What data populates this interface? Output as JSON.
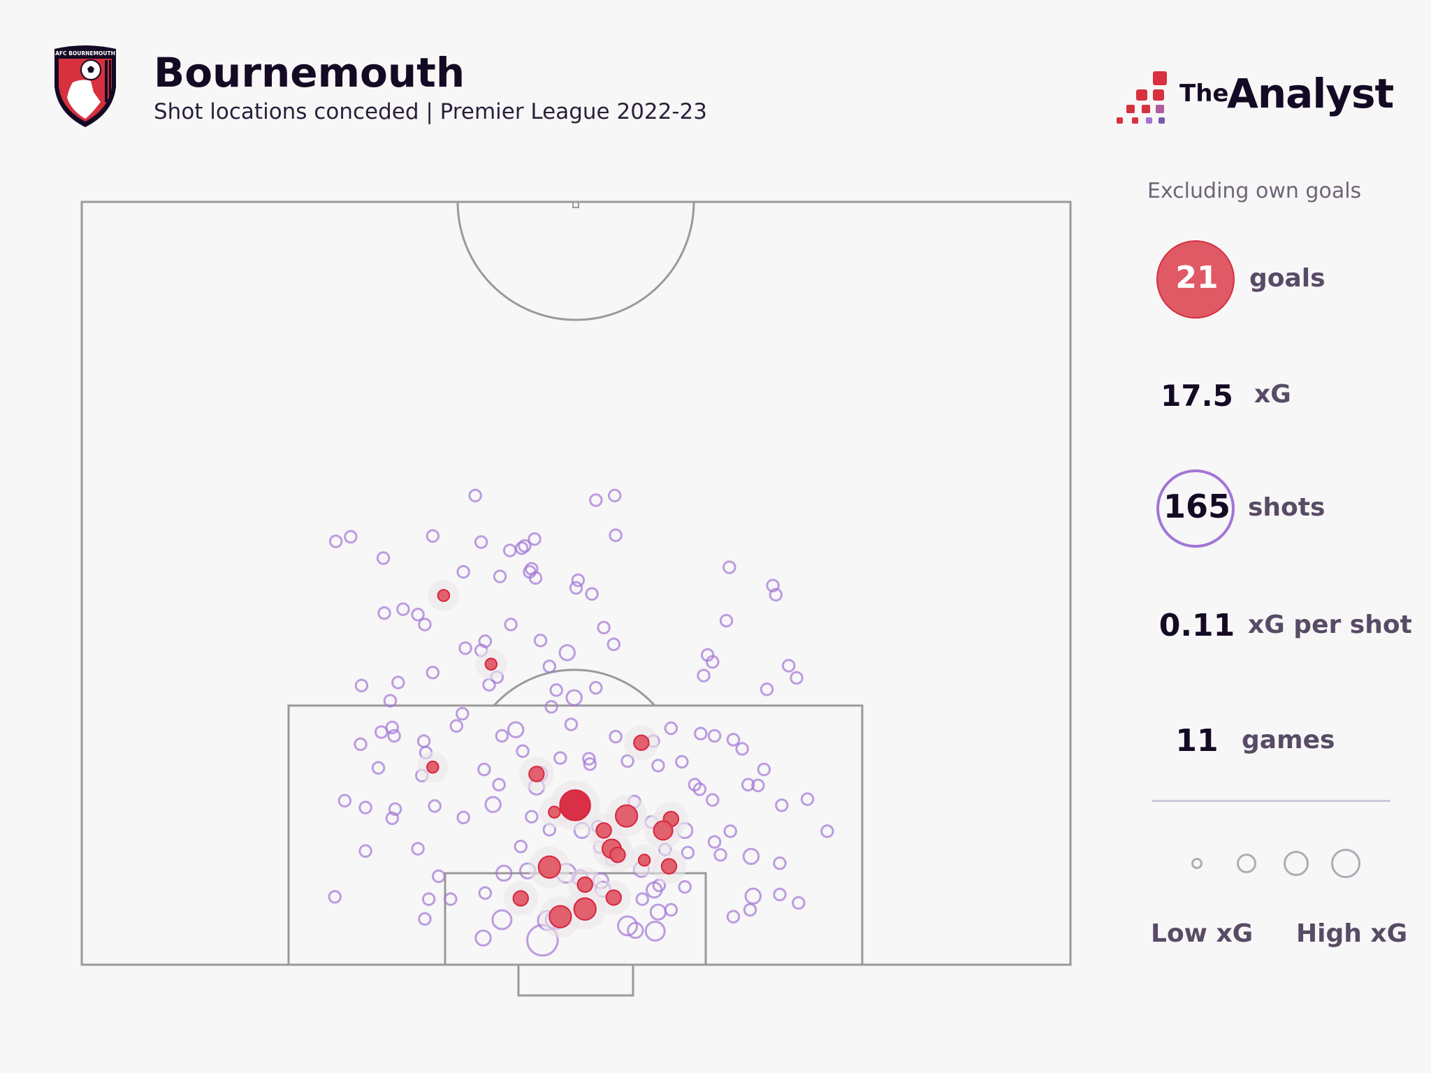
{
  "header": {
    "title": "Bournemouth",
    "subtitle": "Shot locations conceded | Premier League 2022-23",
    "crest_text": "AFC BOURNEMOUTH",
    "brand_the": "The",
    "brand_analyst": "Analyst"
  },
  "colors": {
    "goal": "#d7263d",
    "goal_fill": "#e05a66",
    "shot": "#a375d6",
    "pitch_line": "#9a9a9a",
    "background": "#f7f7f7",
    "brand_red": "#d7303f",
    "brand_purple": "#a375d6"
  },
  "stats": {
    "note": "Excluding own goals",
    "goals": {
      "value": "21",
      "label": "goals"
    },
    "xg": {
      "value": "17.5",
      "label": "xG"
    },
    "shots": {
      "value": "165",
      "label": "shots"
    },
    "xg_per_shot": {
      "value": "0.11",
      "label": "xG per shot"
    },
    "games": {
      "value": "11",
      "label": "games"
    }
  },
  "legend": {
    "low_label": "Low xG",
    "high_label": "High xG",
    "sizes_xg": [
      0.02,
      0.1,
      0.25,
      0.5
    ]
  },
  "chart_data": {
    "type": "scatter",
    "title": "Bournemouth",
    "subtitle": "Shot locations conceded | Premier League 2022-23",
    "xlabel": "",
    "ylabel": "",
    "x_range": [
      0,
      100
    ],
    "y_range": [
      0,
      100
    ],
    "x_description": "Across pitch, left touchline (0) to right touchline (100)",
    "y_description": "Distance from goal line (0) to halfway line (100), percent of half-pitch",
    "grid": false,
    "legend_position": "right",
    "series": [
      {
        "name": "shots",
        "points": [
          {
            "x": 25.7,
            "y": 55.5,
            "xg": 0.02
          },
          {
            "x": 27.2,
            "y": 56.1,
            "xg": 0.02
          },
          {
            "x": 35.5,
            "y": 56.2,
            "xg": 0.02
          },
          {
            "x": 39.8,
            "y": 61.5,
            "xg": 0.02
          },
          {
            "x": 40.4,
            "y": 55.4,
            "xg": 0.02
          },
          {
            "x": 44.5,
            "y": 54.6,
            "xg": 0.02
          },
          {
            "x": 45.8,
            "y": 55.8,
            "xg": 0.02
          },
          {
            "x": 53.9,
            "y": 61.5,
            "xg": 0.02
          },
          {
            "x": 54.0,
            "y": 56.3,
            "xg": 0.02
          },
          {
            "x": 52.0,
            "y": 60.9,
            "xg": 0.02
          },
          {
            "x": 44.8,
            "y": 54.9,
            "xg": 0.02
          },
          {
            "x": 43.3,
            "y": 54.3,
            "xg": 0.02
          },
          {
            "x": 30.5,
            "y": 53.3,
            "xg": 0.02
          },
          {
            "x": 38.6,
            "y": 51.5,
            "xg": 0.02
          },
          {
            "x": 42.3,
            "y": 50.9,
            "xg": 0.02
          },
          {
            "x": 45.3,
            "y": 51.5,
            "xg": 0.02
          },
          {
            "x": 45.9,
            "y": 50.7,
            "xg": 0.02
          },
          {
            "x": 45.5,
            "y": 51.9,
            "xg": 0.02
          },
          {
            "x": 50.2,
            "y": 50.4,
            "xg": 0.02
          },
          {
            "x": 50.0,
            "y": 49.4,
            "xg": 0.02
          },
          {
            "x": 51.6,
            "y": 48.6,
            "xg": 0.02
          },
          {
            "x": 65.5,
            "y": 52.1,
            "xg": 0.02
          },
          {
            "x": 69.9,
            "y": 49.7,
            "xg": 0.02
          },
          {
            "x": 70.2,
            "y": 48.5,
            "xg": 0.02
          },
          {
            "x": 65.2,
            "y": 45.1,
            "xg": 0.02
          },
          {
            "x": 30.6,
            "y": 46.1,
            "xg": 0.02
          },
          {
            "x": 32.5,
            "y": 46.6,
            "xg": 0.02
          },
          {
            "x": 34.0,
            "y": 45.9,
            "xg": 0.02
          },
          {
            "x": 34.7,
            "y": 44.6,
            "xg": 0.02
          },
          {
            "x": 43.4,
            "y": 44.6,
            "xg": 0.02
          },
          {
            "x": 46.4,
            "y": 42.5,
            "xg": 0.02
          },
          {
            "x": 52.8,
            "y": 44.2,
            "xg": 0.02
          },
          {
            "x": 53.8,
            "y": 42.0,
            "xg": 0.02
          },
          {
            "x": 38.8,
            "y": 41.5,
            "xg": 0.02
          },
          {
            "x": 40.4,
            "y": 41.2,
            "xg": 0.02
          },
          {
            "x": 40.8,
            "y": 42.4,
            "xg": 0.02
          },
          {
            "x": 35.5,
            "y": 38.3,
            "xg": 0.02
          },
          {
            "x": 49.1,
            "y": 40.9,
            "xg": 0.05
          },
          {
            "x": 63.3,
            "y": 40.6,
            "xg": 0.02
          },
          {
            "x": 63.8,
            "y": 39.7,
            "xg": 0.02
          },
          {
            "x": 62.9,
            "y": 37.9,
            "xg": 0.02
          },
          {
            "x": 71.5,
            "y": 39.2,
            "xg": 0.02
          },
          {
            "x": 72.3,
            "y": 37.6,
            "xg": 0.02
          },
          {
            "x": 69.3,
            "y": 36.1,
            "xg": 0.02
          },
          {
            "x": 28.3,
            "y": 36.6,
            "xg": 0.02
          },
          {
            "x": 31.2,
            "y": 34.6,
            "xg": 0.02
          },
          {
            "x": 41.2,
            "y": 36.7,
            "xg": 0.02
          },
          {
            "x": 48.0,
            "y": 36.0,
            "xg": 0.02
          },
          {
            "x": 49.8,
            "y": 35.0,
            "xg": 0.05
          },
          {
            "x": 52.0,
            "y": 36.3,
            "xg": 0.02
          },
          {
            "x": 47.5,
            "y": 33.8,
            "xg": 0.02
          },
          {
            "x": 30.3,
            "y": 30.5,
            "xg": 0.02
          },
          {
            "x": 31.4,
            "y": 31.1,
            "xg": 0.02
          },
          {
            "x": 31.6,
            "y": 30.0,
            "xg": 0.02
          },
          {
            "x": 28.2,
            "y": 28.9,
            "xg": 0.02
          },
          {
            "x": 34.6,
            "y": 29.3,
            "xg": 0.02
          },
          {
            "x": 43.9,
            "y": 30.8,
            "xg": 0.05
          },
          {
            "x": 49.5,
            "y": 31.5,
            "xg": 0.02
          },
          {
            "x": 54.0,
            "y": 29.9,
            "xg": 0.02
          },
          {
            "x": 59.6,
            "y": 31.0,
            "xg": 0.02
          },
          {
            "x": 62.6,
            "y": 30.3,
            "xg": 0.02
          },
          {
            "x": 64.0,
            "y": 30.0,
            "xg": 0.02
          },
          {
            "x": 65.9,
            "y": 29.5,
            "xg": 0.02
          },
          {
            "x": 66.8,
            "y": 28.3,
            "xg": 0.02
          },
          {
            "x": 34.8,
            "y": 27.8,
            "xg": 0.02
          },
          {
            "x": 44.6,
            "y": 28.0,
            "xg": 0.02
          },
          {
            "x": 48.4,
            "y": 27.1,
            "xg": 0.02
          },
          {
            "x": 55.2,
            "y": 26.7,
            "xg": 0.02
          },
          {
            "x": 57.8,
            "y": 29.3,
            "xg": 0.02
          },
          {
            "x": 30.0,
            "y": 25.8,
            "xg": 0.02
          },
          {
            "x": 34.4,
            "y": 24.8,
            "xg": 0.02
          },
          {
            "x": 42.2,
            "y": 23.6,
            "xg": 0.02
          },
          {
            "x": 62.0,
            "y": 23.6,
            "xg": 0.02
          },
          {
            "x": 62.5,
            "y": 23.0,
            "xg": 0.02
          },
          {
            "x": 67.4,
            "y": 23.6,
            "xg": 0.02
          },
          {
            "x": 68.4,
            "y": 23.5,
            "xg": 0.02
          },
          {
            "x": 26.6,
            "y": 21.5,
            "xg": 0.02
          },
          {
            "x": 28.7,
            "y": 20.6,
            "xg": 0.02
          },
          {
            "x": 31.7,
            "y": 20.4,
            "xg": 0.02
          },
          {
            "x": 35.7,
            "y": 20.8,
            "xg": 0.02
          },
          {
            "x": 41.6,
            "y": 21.0,
            "xg": 0.05
          },
          {
            "x": 55.9,
            "y": 21.4,
            "xg": 0.02
          },
          {
            "x": 63.8,
            "y": 21.6,
            "xg": 0.02
          },
          {
            "x": 70.8,
            "y": 20.9,
            "xg": 0.02
          },
          {
            "x": 31.4,
            "y": 19.2,
            "xg": 0.02
          },
          {
            "x": 38.6,
            "y": 19.3,
            "xg": 0.02
          },
          {
            "x": 45.5,
            "y": 19.4,
            "xg": 0.02
          },
          {
            "x": 47.3,
            "y": 17.7,
            "xg": 0.02
          },
          {
            "x": 50.6,
            "y": 17.6,
            "xg": 0.05
          },
          {
            "x": 52.2,
            "y": 18.1,
            "xg": 0.02
          },
          {
            "x": 57.6,
            "y": 18.7,
            "xg": 0.02
          },
          {
            "x": 59.3,
            "y": 17.5,
            "xg": 0.02
          },
          {
            "x": 61.0,
            "y": 17.6,
            "xg": 0.05
          },
          {
            "x": 65.6,
            "y": 17.5,
            "xg": 0.02
          },
          {
            "x": 75.4,
            "y": 17.5,
            "xg": 0.02
          },
          {
            "x": 28.7,
            "y": 14.9,
            "xg": 0.02
          },
          {
            "x": 34.0,
            "y": 15.2,
            "xg": 0.02
          },
          {
            "x": 44.4,
            "y": 15.5,
            "xg": 0.02
          },
          {
            "x": 52.4,
            "y": 15.4,
            "xg": 0.02
          },
          {
            "x": 53.6,
            "y": 15.3,
            "xg": 0.05
          },
          {
            "x": 59.0,
            "y": 15.1,
            "xg": 0.02
          },
          {
            "x": 61.3,
            "y": 14.7,
            "xg": 0.02
          },
          {
            "x": 64.6,
            "y": 14.4,
            "xg": 0.02
          },
          {
            "x": 67.7,
            "y": 14.2,
            "xg": 0.05
          },
          {
            "x": 70.6,
            "y": 13.3,
            "xg": 0.02
          },
          {
            "x": 36.1,
            "y": 11.6,
            "xg": 0.02
          },
          {
            "x": 42.7,
            "y": 12.0,
            "xg": 0.05
          },
          {
            "x": 45.1,
            "y": 12.3,
            "xg": 0.05
          },
          {
            "x": 50.4,
            "y": 11.4,
            "xg": 0.05
          },
          {
            "x": 52.7,
            "y": 9.9,
            "xg": 0.05
          },
          {
            "x": 58.4,
            "y": 10.4,
            "xg": 0.02
          },
          {
            "x": 61.0,
            "y": 10.2,
            "xg": 0.02
          },
          {
            "x": 35.1,
            "y": 8.6,
            "xg": 0.02
          },
          {
            "x": 37.3,
            "y": 8.6,
            "xg": 0.02
          },
          {
            "x": 49.0,
            "y": 12.0,
            "xg": 0.1
          },
          {
            "x": 52.5,
            "y": 11.0,
            "xg": 0.05
          },
          {
            "x": 57.9,
            "y": 9.8,
            "xg": 0.05
          },
          {
            "x": 56.7,
            "y": 8.6,
            "xg": 0.02
          },
          {
            "x": 67.9,
            "y": 9.0,
            "xg": 0.05
          },
          {
            "x": 70.6,
            "y": 9.2,
            "xg": 0.02
          },
          {
            "x": 59.6,
            "y": 7.2,
            "xg": 0.02
          },
          {
            "x": 58.3,
            "y": 6.9,
            "xg": 0.05
          },
          {
            "x": 65.9,
            "y": 6.3,
            "xg": 0.02
          },
          {
            "x": 67.6,
            "y": 7.2,
            "xg": 0.02
          },
          {
            "x": 25.6,
            "y": 8.9,
            "xg": 0.02
          },
          {
            "x": 40.8,
            "y": 9.4,
            "xg": 0.02
          },
          {
            "x": 47.1,
            "y": 5.8,
            "xg": 0.1
          },
          {
            "x": 47.9,
            "y": 5.9,
            "xg": 0.1
          },
          {
            "x": 55.2,
            "y": 5.1,
            "xg": 0.1
          },
          {
            "x": 56.0,
            "y": 4.5,
            "xg": 0.05
          },
          {
            "x": 72.5,
            "y": 8.1,
            "xg": 0.02
          },
          {
            "x": 34.7,
            "y": 6.0,
            "xg": 0.02
          },
          {
            "x": 42.5,
            "y": 5.9,
            "xg": 0.1
          },
          {
            "x": 40.6,
            "y": 3.5,
            "xg": 0.05
          },
          {
            "x": 46.6,
            "y": 3.2,
            "xg": 0.35
          },
          {
            "x": 58.0,
            "y": 4.4,
            "xg": 0.1
          },
          {
            "x": 53.6,
            "y": 13.8,
            "xg": 0.02
          },
          {
            "x": 56.6,
            "y": 12.5,
            "xg": 0.05
          },
          {
            "x": 38.5,
            "y": 32.9,
            "xg": 0.02
          },
          {
            "x": 46.0,
            "y": 23.3,
            "xg": 0.05
          },
          {
            "x": 47.3,
            "y": 39.1,
            "xg": 0.02
          },
          {
            "x": 42.5,
            "y": 30.0,
            "xg": 0.02
          },
          {
            "x": 42.0,
            "y": 37.7,
            "xg": 0.02
          },
          {
            "x": 40.7,
            "y": 25.6,
            "xg": 0.02
          },
          {
            "x": 46.3,
            "y": 25.0,
            "xg": 0.05
          },
          {
            "x": 37.9,
            "y": 31.3,
            "xg": 0.02
          },
          {
            "x": 32.0,
            "y": 37.0,
            "xg": 0.02
          },
          {
            "x": 51.3,
            "y": 27.0,
            "xg": 0.02
          },
          {
            "x": 51.4,
            "y": 26.3,
            "xg": 0.02
          },
          {
            "x": 58.3,
            "y": 26.1,
            "xg": 0.02
          },
          {
            "x": 60.7,
            "y": 26.6,
            "xg": 0.02
          },
          {
            "x": 69.0,
            "y": 25.6,
            "xg": 0.02
          },
          {
            "x": 73.4,
            "y": 21.7,
            "xg": 0.02
          },
          {
            "x": 64.0,
            "y": 16.1,
            "xg": 0.02
          }
        ]
      },
      {
        "name": "goals",
        "points": [
          {
            "x": 36.6,
            "y": 48.4,
            "xg": 0.02
          },
          {
            "x": 41.4,
            "y": 39.4,
            "xg": 0.02
          },
          {
            "x": 35.5,
            "y": 25.9,
            "xg": 0.02
          },
          {
            "x": 56.6,
            "y": 29.1,
            "xg": 0.05
          },
          {
            "x": 46.0,
            "y": 25.0,
            "xg": 0.05
          },
          {
            "x": 49.9,
            "y": 20.9,
            "xg": 0.35
          },
          {
            "x": 59.6,
            "y": 19.1,
            "xg": 0.05
          },
          {
            "x": 47.8,
            "y": 20.0,
            "xg": 0.02
          },
          {
            "x": 55.1,
            "y": 19.5,
            "xg": 0.15
          },
          {
            "x": 52.8,
            "y": 17.6,
            "xg": 0.05
          },
          {
            "x": 58.8,
            "y": 17.6,
            "xg": 0.1
          },
          {
            "x": 53.6,
            "y": 15.2,
            "xg": 0.1
          },
          {
            "x": 54.2,
            "y": 14.4,
            "xg": 0.05
          },
          {
            "x": 47.3,
            "y": 12.8,
            "xg": 0.15
          },
          {
            "x": 50.9,
            "y": 10.5,
            "xg": 0.05
          },
          {
            "x": 53.8,
            "y": 8.8,
            "xg": 0.05
          },
          {
            "x": 44.4,
            "y": 8.7,
            "xg": 0.05
          },
          {
            "x": 48.4,
            "y": 6.3,
            "xg": 0.15
          },
          {
            "x": 50.9,
            "y": 7.3,
            "xg": 0.15
          },
          {
            "x": 56.9,
            "y": 13.7,
            "xg": 0.02
          },
          {
            "x": 59.4,
            "y": 12.9,
            "xg": 0.05
          }
        ]
      }
    ]
  }
}
